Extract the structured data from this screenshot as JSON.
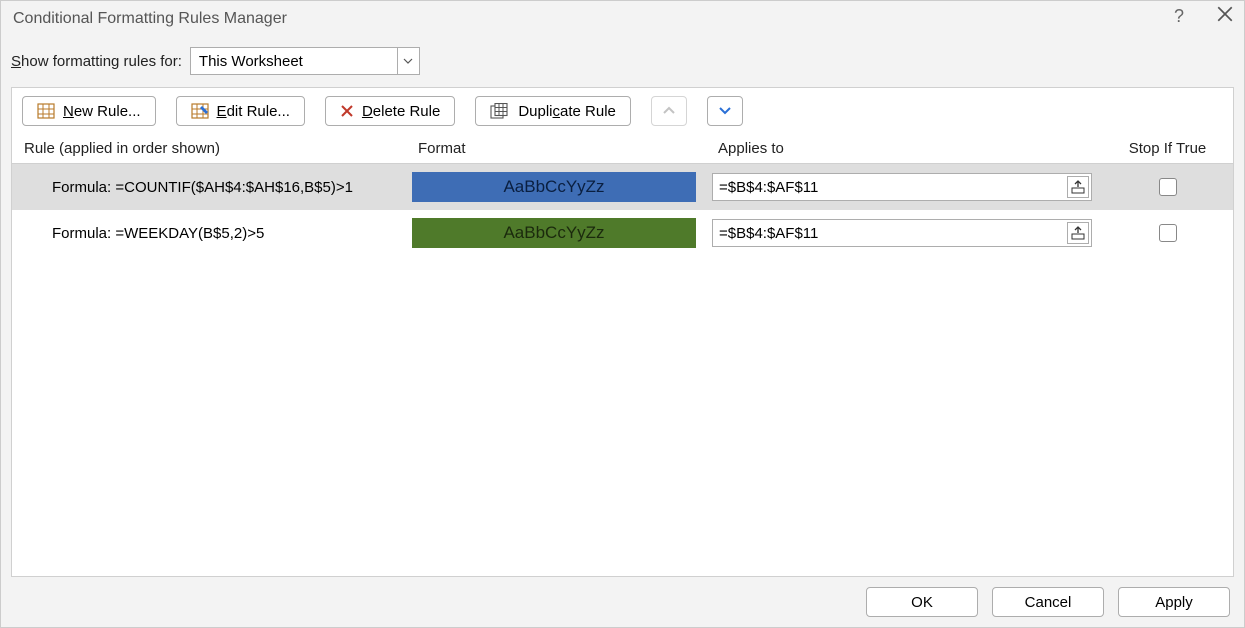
{
  "titlebar": {
    "title": "Conditional Formatting Rules Manager"
  },
  "scope": {
    "label_pre": "S",
    "label_post": "how formatting rules for:",
    "selected": "This Worksheet"
  },
  "toolbar": {
    "new_rule_pre": "N",
    "new_rule_post": "ew Rule...",
    "edit_rule_pre": "E",
    "edit_rule_post": "dit Rule...",
    "delete_rule_pre": "D",
    "delete_rule_post": "elete Rule",
    "duplicate_rule_pre": "Dupli",
    "duplicate_rule_post": "ate Rule",
    "duplicate_rule_mid": "c"
  },
  "columns": {
    "rule": "Rule (applied in order shown)",
    "format": "Format",
    "applies_to": "Applies to",
    "stop_if_true": "Stop If True"
  },
  "format_preview_text": "AaBbCcYyZz",
  "rules": [
    {
      "description": "Formula: =COUNTIF($AH$4:$AH$16,B$5)>1",
      "swatch_class": "swatch-blue",
      "applies_to": "=$B$4:$AF$11",
      "selected": true
    },
    {
      "description": "Formula: =WEEKDAY(B$5,2)>5",
      "swatch_class": "swatch-green",
      "applies_to": "=$B$4:$AF$11",
      "selected": false
    }
  ],
  "footer": {
    "ok": "OK",
    "cancel": "Cancel",
    "apply": "Apply"
  }
}
